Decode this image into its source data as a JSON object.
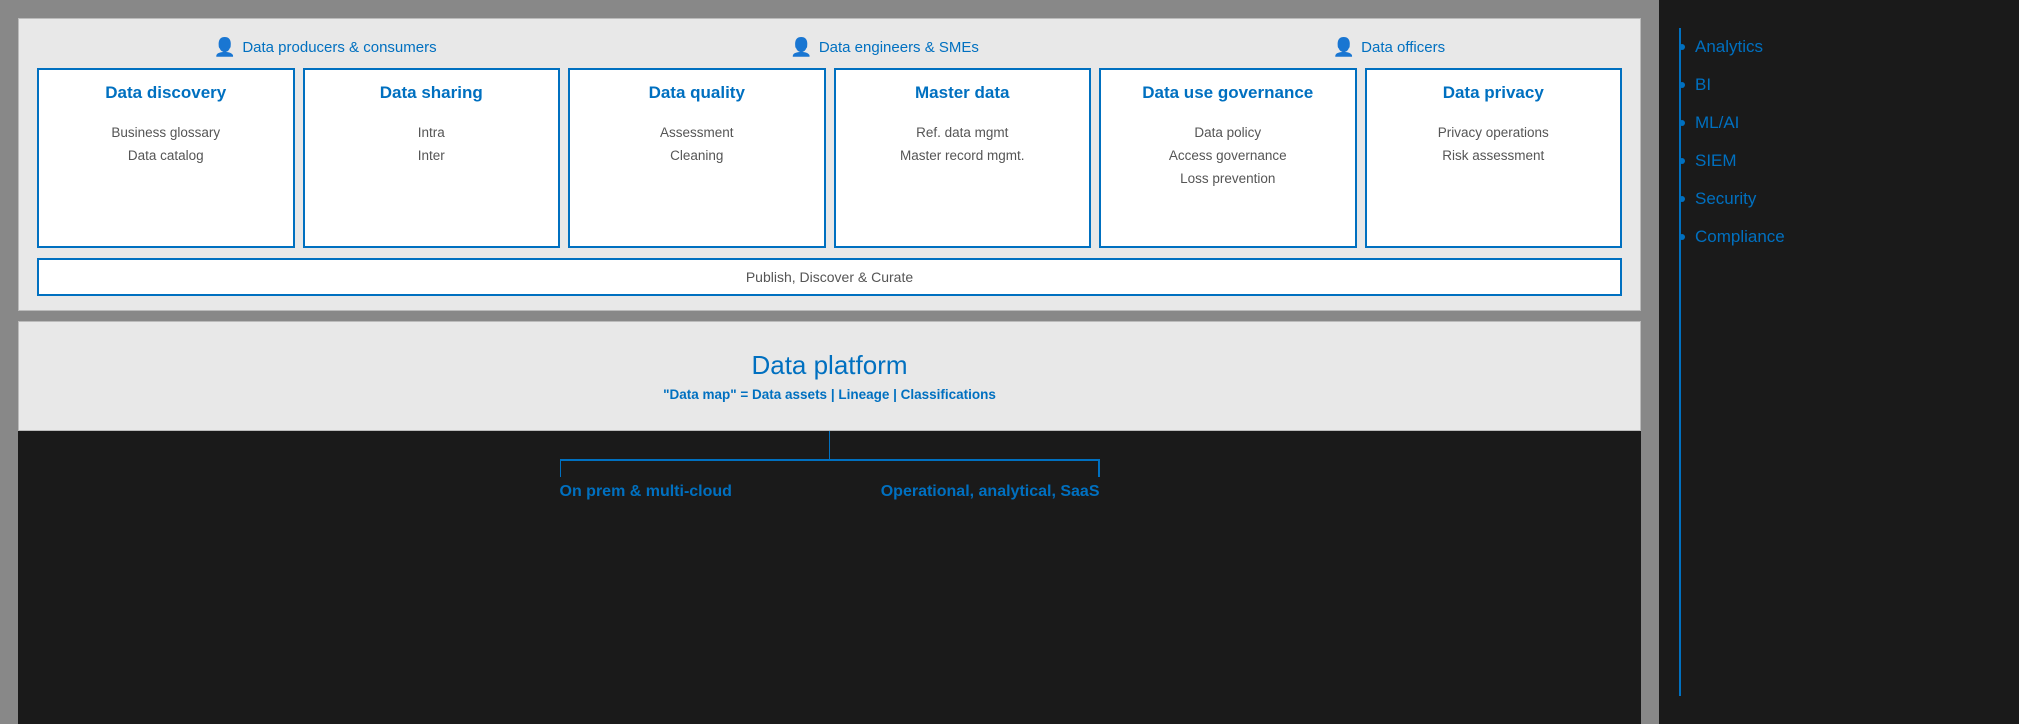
{
  "personas": [
    {
      "label": "Data producers & consumers"
    },
    {
      "label": "Data engineers & SMEs"
    },
    {
      "label": "Data officers"
    }
  ],
  "cards": [
    {
      "title": "Data discovery",
      "items": [
        "Business glossary",
        "Data catalog"
      ]
    },
    {
      "title": "Data sharing",
      "items": [
        "Intra",
        "Inter"
      ]
    },
    {
      "title": "Data quality",
      "items": [
        "Assessment",
        "Cleaning"
      ]
    },
    {
      "title": "Master data",
      "items": [
        "Ref. data mgmt",
        "Master record mgmt."
      ]
    },
    {
      "title": "Data use governance",
      "items": [
        "Data policy",
        "Access governance",
        "Loss prevention"
      ]
    },
    {
      "title": "Data privacy",
      "items": [
        "Privacy operations",
        "Risk assessment"
      ]
    }
  ],
  "publish_bar": "Publish, Discover & Curate",
  "platform": {
    "title": "Data platform",
    "subtitle": "\"Data map\" = Data assets | Lineage | Classifications"
  },
  "branches": [
    {
      "label": "On prem & multi-cloud"
    },
    {
      "label": "Operational, analytical, SaaS"
    }
  ],
  "sidebar": {
    "items": [
      {
        "label": "Analytics"
      },
      {
        "label": "BI"
      },
      {
        "label": "ML/AI"
      },
      {
        "label": "SIEM"
      },
      {
        "label": "Security"
      },
      {
        "label": "Compliance"
      }
    ]
  }
}
